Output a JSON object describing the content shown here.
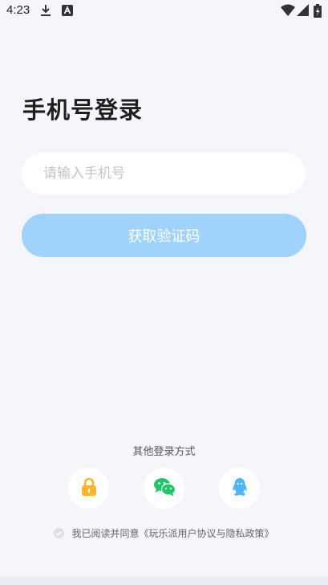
{
  "status_bar": {
    "time": "4:23",
    "icons": [
      "download-icon",
      "a-icon",
      "wifi-icon",
      "signal-icon",
      "battery-icon"
    ]
  },
  "login": {
    "title": "手机号登录",
    "phone_placeholder": "请输入手机号",
    "phone_value": "",
    "get_code_label": "获取验证码"
  },
  "other_login": {
    "label": "其他登录方式",
    "options": [
      "lock-icon",
      "wechat-icon",
      "qq-icon"
    ]
  },
  "agreement": {
    "text": "我已阅读并同意《玩乐派用户协议与隐私政策》",
    "checked": false
  },
  "colors": {
    "accent": "#9fd3fb",
    "background": "#f4f6fb",
    "lock": "#ffb52b",
    "wechat": "#1fc567",
    "qq": "#4fb6f6"
  }
}
